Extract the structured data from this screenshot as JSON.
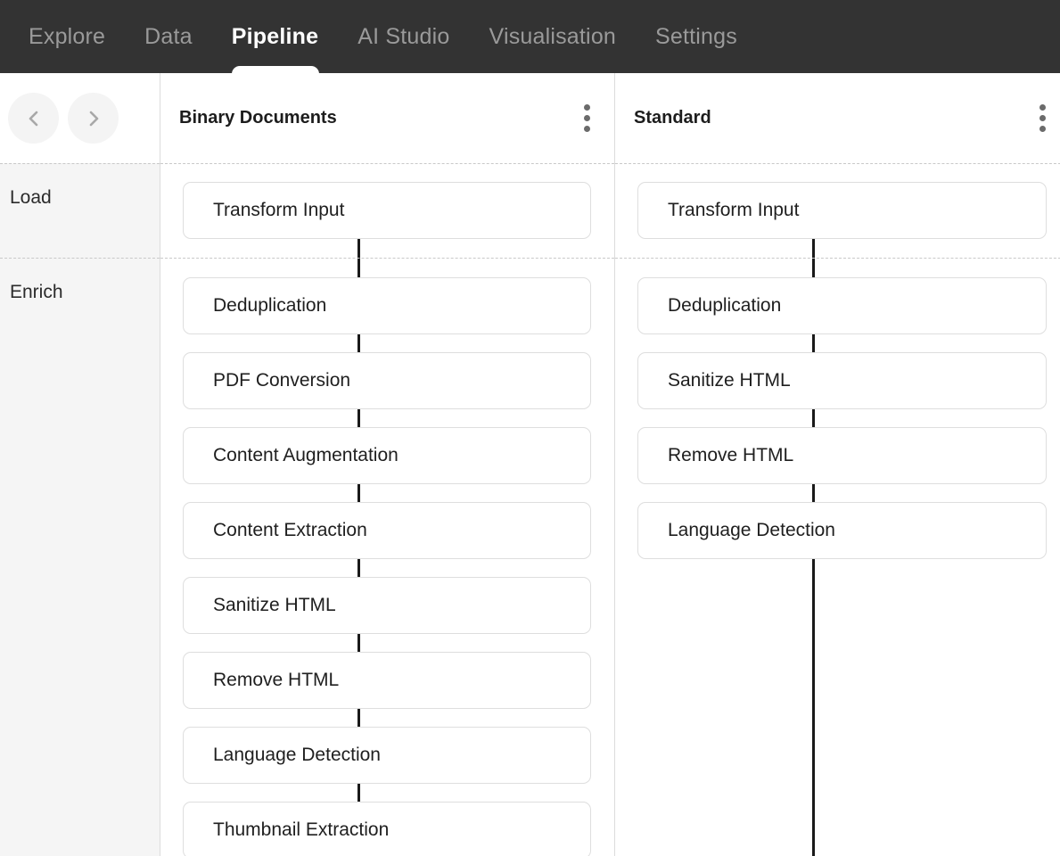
{
  "nav": {
    "tabs": [
      {
        "label": "Explore",
        "active": false
      },
      {
        "label": "Data",
        "active": false
      },
      {
        "label": "Pipeline",
        "active": true
      },
      {
        "label": "AI Studio",
        "active": false
      },
      {
        "label": "Visualisation",
        "active": false
      },
      {
        "label": "Settings",
        "active": false
      }
    ]
  },
  "rail": {
    "prev_label": "chevron-left",
    "next_label": "chevron-right",
    "rows": [
      {
        "label": "Load"
      },
      {
        "label": "Enrich"
      }
    ]
  },
  "columns": [
    {
      "title": "Binary Documents",
      "menu": "more-vertical",
      "load": [
        "Transform Input"
      ],
      "enrich": [
        "Deduplication",
        "PDF Conversion",
        "Content Augmentation",
        "Content Extraction",
        "Sanitize HTML",
        "Remove HTML",
        "Language Detection",
        "Thumbnail Extraction"
      ]
    },
    {
      "title": "Standard",
      "menu": "more-vertical",
      "load": [
        "Transform Input"
      ],
      "enrich": [
        "Deduplication",
        "Sanitize HTML",
        "Remove HTML",
        "Language Detection"
      ]
    }
  ],
  "colors": {
    "topnav_bg": "#333333",
    "tab_inactive": "#9a9a9a",
    "tab_active": "#ffffff",
    "rail_bg": "#f5f5f5",
    "card_border": "#dedede",
    "connector": "#1a1a1a",
    "divider": "#dcdcdc"
  }
}
